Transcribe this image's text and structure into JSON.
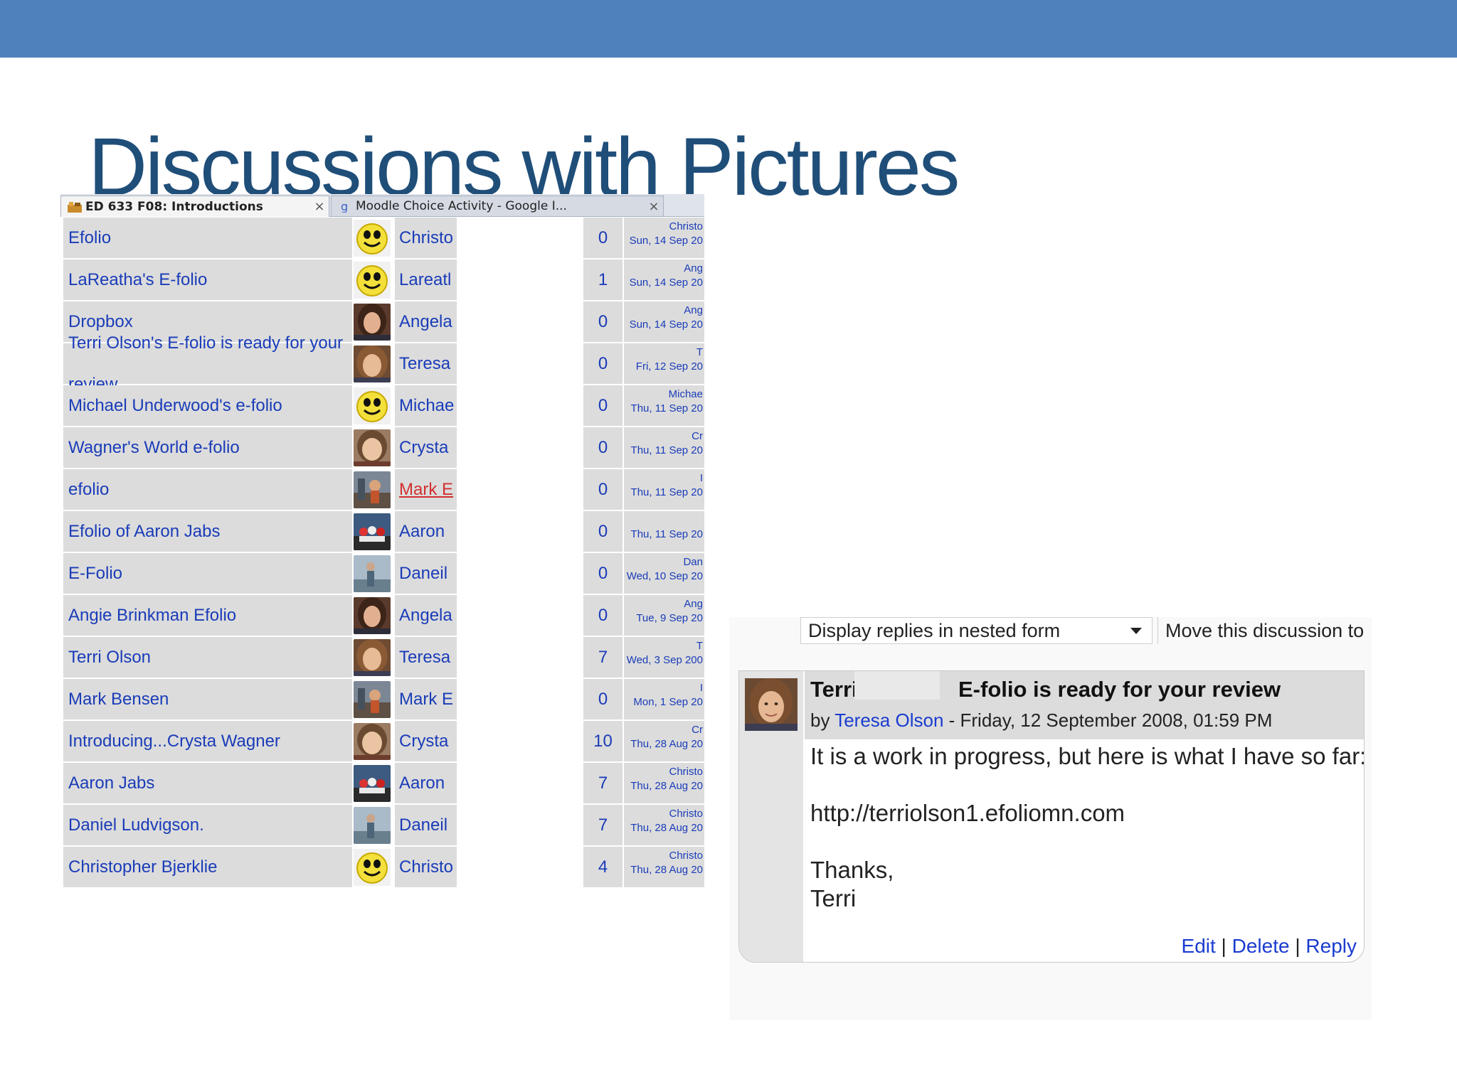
{
  "slide": {
    "title": "Discussions with Pictures",
    "accent_color": "#4f81bd",
    "title_color": "#1f4e79"
  },
  "browser_tabs": [
    {
      "label": "ED 633 F08: Introductions",
      "icon": "moodle-icon",
      "close": "×"
    },
    {
      "label": "Moodle Choice Activity - Google I...",
      "icon": "google-icon",
      "close": "×"
    }
  ],
  "discussions": [
    {
      "topic": "Efolio",
      "avatar": "smiley",
      "author": "Christo",
      "replies": "0",
      "last_name": "Christo",
      "last_date": "Sun, 14 Sep 20"
    },
    {
      "topic": "LaReatha's E-folio",
      "avatar": "smiley",
      "author": "Lareatl",
      "replies": "1",
      "last_name": "Ang",
      "last_date": "Sun, 14 Sep 20"
    },
    {
      "topic": "Dropbox",
      "avatar": "photo-a",
      "author": "Angela",
      "replies": "0",
      "last_name": "Ang",
      "last_date": "Sun, 14 Sep 20"
    },
    {
      "topic": "Terri Olson's E-folio is ready for your",
      "topic_line2": "review",
      "avatar": "photo-t",
      "author": "Teresa",
      "replies": "0",
      "last_name": "T",
      "last_date": "Fri, 12 Sep 20"
    },
    {
      "topic": "Michael Underwood's e-folio",
      "avatar": "smiley",
      "author": "Michae",
      "replies": "0",
      "last_name": "Michae",
      "last_date": "Thu, 11 Sep 20"
    },
    {
      "topic": "Wagner's World e-folio",
      "avatar": "photo-c",
      "author": "Crysta",
      "replies": "0",
      "last_name": "Cr",
      "last_date": "Thu, 11 Sep 20"
    },
    {
      "topic": "efolio",
      "avatar": "photo-m",
      "author": "Mark E",
      "author_red": true,
      "replies": "0",
      "last_name": "I",
      "last_date": "Thu, 11 Sep 20"
    },
    {
      "topic": "Efolio of Aaron Jabs",
      "avatar": "photo-j",
      "author": "Aaron",
      "replies": "0",
      "last_name": "",
      "last_date": "Thu, 11 Sep 20"
    },
    {
      "topic": "E-Folio",
      "avatar": "photo-d",
      "author": "Daneil",
      "replies": "0",
      "last_name": "Dan",
      "last_date": "Wed, 10 Sep 20"
    },
    {
      "topic": "Angie Brinkman Efolio",
      "avatar": "photo-a",
      "author": "Angela",
      "replies": "0",
      "last_name": "Ang",
      "last_date": "Tue, 9 Sep 20"
    },
    {
      "topic": "Terri Olson",
      "avatar": "photo-t",
      "author": "Teresa",
      "replies": "7",
      "last_name": "T",
      "last_date": "Wed, 3 Sep 200"
    },
    {
      "topic": "Mark Bensen",
      "avatar": "photo-m",
      "author": "Mark E",
      "replies": "0",
      "last_name": "I",
      "last_date": "Mon, 1 Sep 20"
    },
    {
      "topic": "Introducing...Crysta Wagner",
      "avatar": "photo-c",
      "author": "Crysta",
      "replies": "10",
      "last_name": "Cr",
      "last_date": "Thu, 28 Aug 20"
    },
    {
      "topic": "Aaron Jabs",
      "avatar": "photo-j",
      "author": "Aaron",
      "replies": "7",
      "last_name": "Christo",
      "last_date": "Thu, 28 Aug 20"
    },
    {
      "topic": "Daniel Ludvigson.",
      "avatar": "photo-d",
      "author": "Daneil",
      "replies": "7",
      "last_name": "Christo",
      "last_date": "Thu, 28 Aug 20"
    },
    {
      "topic": "Christopher Bjerklie",
      "avatar": "smiley",
      "author": "Christo",
      "replies": "4",
      "last_name": "Christo",
      "last_date": "Thu, 28 Aug 20"
    }
  ],
  "post_view": {
    "display_mode": "Display replies in nested form",
    "move_label": "Move this discussion to",
    "subject_first": "Terri",
    "subject_rest": "E-folio is ready for your review",
    "by_prefix": "by ",
    "author": "Teresa Olson",
    "date": " - Friday, 12 September 2008, 01:59 PM",
    "body": [
      "It is a work in progress, but here is what I have so far:",
      "",
      "http://terriolson1.efoliomn.com",
      "",
      "Thanks,",
      "Terri"
    ],
    "actions": {
      "edit": "Edit",
      "sep1": " | ",
      "delete": "Delete",
      "sep2": " | ",
      "reply": "Reply"
    }
  }
}
